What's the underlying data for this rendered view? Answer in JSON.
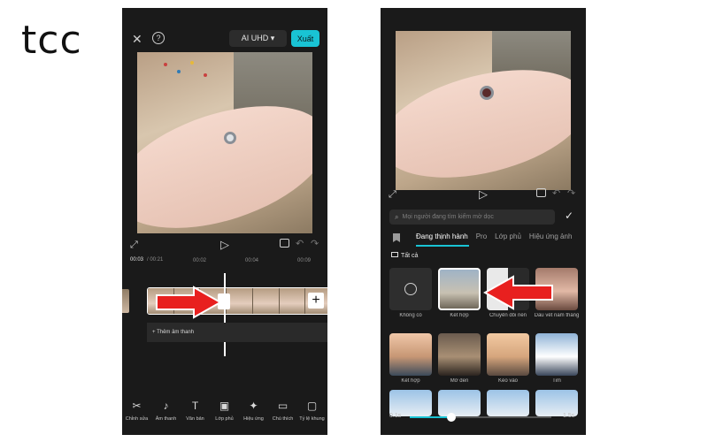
{
  "brand": {
    "logo_text": "tcc"
  },
  "left_screen": {
    "topbar": {
      "close_icon": "✕",
      "help_icon": "?",
      "quality_label": "AI UHD ▾",
      "export_label": "Xuất"
    },
    "controls": {
      "fullscreen_icon": "⤢",
      "play_icon": "▷",
      "undo_icon": "↶",
      "redo_icon": "↷"
    },
    "time_current": "00:03",
    "time_total": "/ 00:21",
    "ruler_ticks": [
      "00:02",
      "00:04",
      "00:09"
    ],
    "add_audio_label": "+ Thêm âm thanh",
    "add_clip_icon": "+",
    "toolbar": [
      {
        "icon": "✂",
        "label": "Chỉnh sửa"
      },
      {
        "icon": "♪",
        "label": "Âm thanh"
      },
      {
        "icon": "T",
        "label": "Văn bản"
      },
      {
        "icon": "▣",
        "label": "Lớp phủ"
      },
      {
        "icon": "✦",
        "label": "Hiệu ứng"
      },
      {
        "icon": "▭",
        "label": "Chú thích"
      },
      {
        "icon": "▢",
        "label": "Tỷ lệ khung"
      }
    ]
  },
  "right_screen": {
    "search_placeholder": "Mọi người đang tìm kiếm mờ dọc",
    "confirm_icon": "✓",
    "tabs": [
      "Đang thịnh hành",
      "Pro",
      "Lớp phủ",
      "Hiệu ứng ảnh"
    ],
    "active_tab": "Đang thịnh hành",
    "all_label": "Tất cả",
    "transitions_row1": [
      "Không có",
      "Kết hợp",
      "Chuyển đổi nền",
      "Dấu vết năm tháng"
    ],
    "transitions_row2": [
      "Kết hợp",
      "Mờ đen",
      "Kéo vào",
      "Tim"
    ],
    "slider": {
      "min_label": "0.1s",
      "max_label": "1.5s",
      "value_fraction": 0.28
    }
  },
  "colors": {
    "accent": "#19c3d4",
    "arrow": "#e8201f",
    "panel": "#1a1a1a"
  }
}
